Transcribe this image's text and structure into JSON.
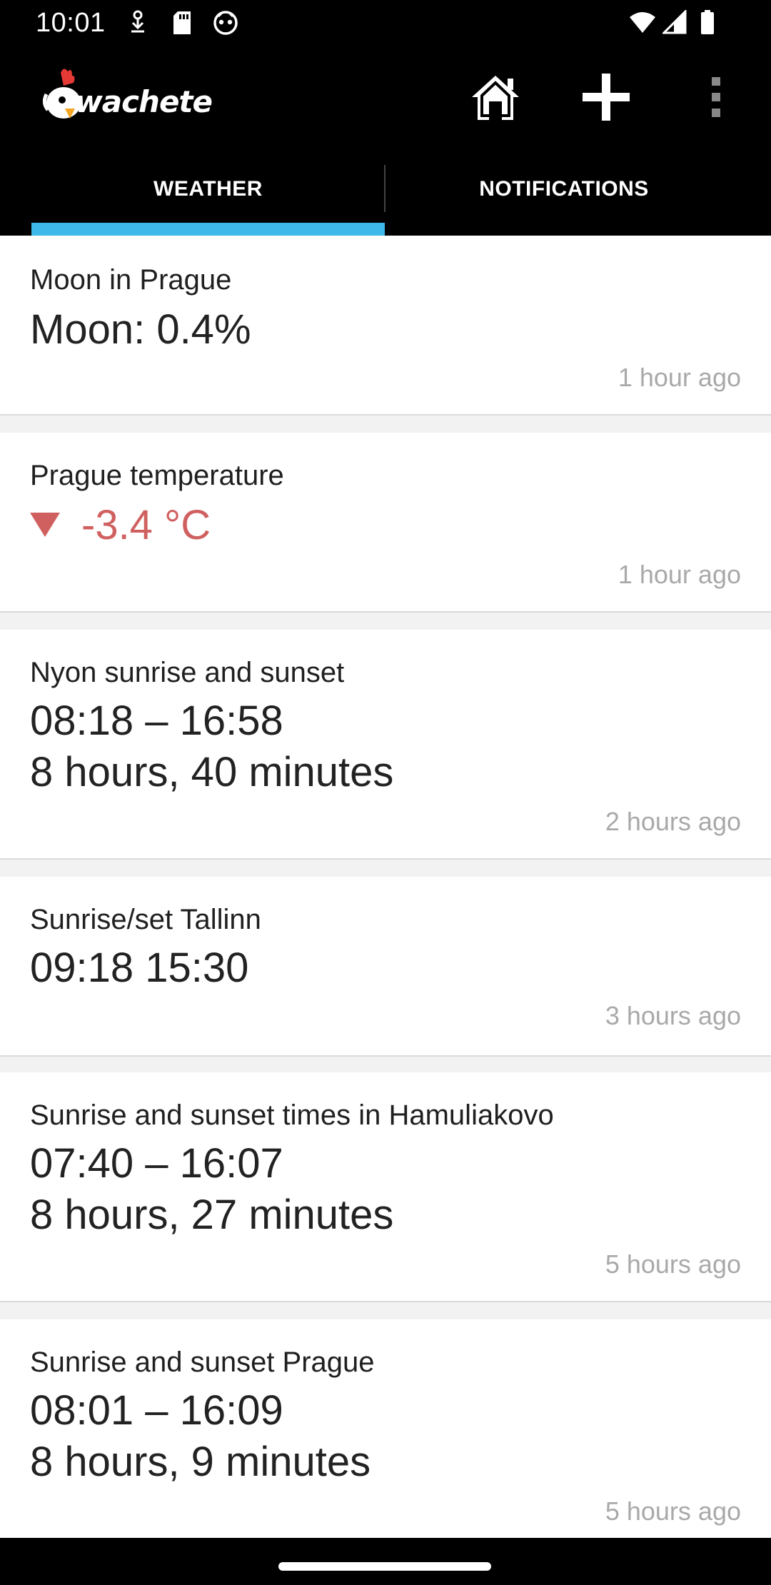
{
  "status_bar": {
    "time": "10:01",
    "left_icons": [
      "download-icon",
      "sd-card-icon",
      "game-icon"
    ],
    "right_icons": [
      "wifi-icon",
      "cell-signal-icon",
      "battery-icon"
    ]
  },
  "app_bar": {
    "logo_text": "wachete",
    "actions": [
      "home-icon",
      "add-icon",
      "more-icon"
    ]
  },
  "tabs": [
    {
      "label": "WEATHER",
      "selected": true
    },
    {
      "label": "NOTIFICATIONS",
      "selected": false
    }
  ],
  "colors": {
    "accent": "#3db8e8",
    "down": "#d06060",
    "logo_red": "#e53935"
  },
  "cards": [
    {
      "title": "Moon in Prague",
      "value": "Moon: 0.4%",
      "time": "1 hour ago"
    },
    {
      "title": "Prague temperature",
      "value": "-3.4 °C",
      "trend": "down",
      "time": "1 hour ago"
    },
    {
      "title": "Nyon sunrise and sunset",
      "value": "08:18 – 16:58\n8 hours, 40 minutes",
      "time": "2 hours ago"
    },
    {
      "title": "Sunrise/set Tallinn",
      "value": "09:18 15:30",
      "time": "3 hours ago"
    },
    {
      "title": "Sunrise and sunset times in Hamuliakovo",
      "value": "07:40 – 16:07\n8 hours, 27 minutes",
      "time": "5 hours ago"
    },
    {
      "title": "Sunrise and sunset Prague",
      "value": "08:01 – 16:09\n8 hours, 9 minutes",
      "time": "5 hours ago"
    }
  ]
}
